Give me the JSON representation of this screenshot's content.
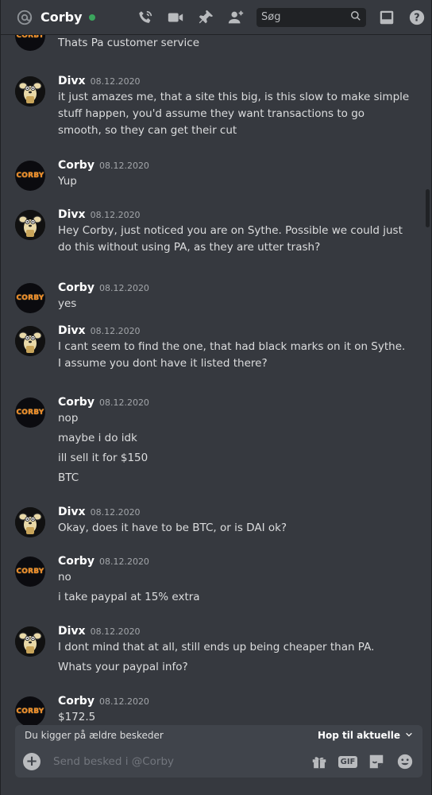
{
  "header": {
    "title": "Corby",
    "search_placeholder": "Søg",
    "icons": [
      "at-icon",
      "call-icon",
      "video-icon",
      "pin-icon",
      "add-friend-icon",
      "search-icon",
      "inbox-icon",
      "help-icon"
    ],
    "status_color": "#3ba55d"
  },
  "messages": [
    {
      "author": "",
      "time": "",
      "lines": [
        "Thats Pa customer service"
      ]
    },
    {
      "author": "Divx",
      "time": "08.12.2020",
      "lines": [
        "it just amazes me, that a site this big, is this slow to make simple",
        "stuff happen, you'd assume they want transactions to go",
        "smooth, so they can get their cut"
      ]
    },
    {
      "author": "Corby",
      "time": "08.12.2020",
      "lines": [
        "Yup"
      ]
    },
    {
      "author": "Divx",
      "time": "08.12.2020",
      "lines": [
        "Hey Corby, just noticed you are on Sythe. Possible we could just",
        "do this without using PA, as they are utter trash?"
      ]
    },
    {
      "author": "Corby",
      "time": "08.12.2020",
      "lines": [
        "yes"
      ]
    },
    {
      "author": "Divx",
      "time": "08.12.2020",
      "lines": [
        "I cant seem to find the one, that had black marks on it on Sythe.",
        "I assume you dont have it listed there?"
      ]
    },
    {
      "author": "Corby",
      "time": "08.12.2020",
      "lines": [
        "nop",
        "maybe i do idk",
        "ill sell it for $150",
        "BTC"
      ]
    },
    {
      "author": "Divx",
      "time": "08.12.2020",
      "lines": [
        "Okay, does it have to be BTC, or is DAI ok?"
      ]
    },
    {
      "author": "Corby",
      "time": "08.12.2020",
      "lines": [
        "no",
        "i take paypal at 15% extra"
      ]
    },
    {
      "author": "Divx",
      "time": "08.12.2020",
      "lines": [
        "I dont mind that at all, still ends up being cheaper than PA.",
        "Whats your paypal info?"
      ]
    },
    {
      "author": "Corby",
      "time": "08.12.2020",
      "lines": [
        "$172.5"
      ]
    }
  ],
  "avatar_logo_text": "CORBY",
  "older_bar": {
    "text": "Du kigger på ældre beskeder",
    "jump_label": "Hop til aktuelle"
  },
  "composer": {
    "placeholder": "Send besked i @Corby",
    "gif_label": "GIF",
    "icons": [
      "add-attachment-icon",
      "gift-icon",
      "gif-icon",
      "sticker-icon",
      "emoji-icon"
    ]
  }
}
